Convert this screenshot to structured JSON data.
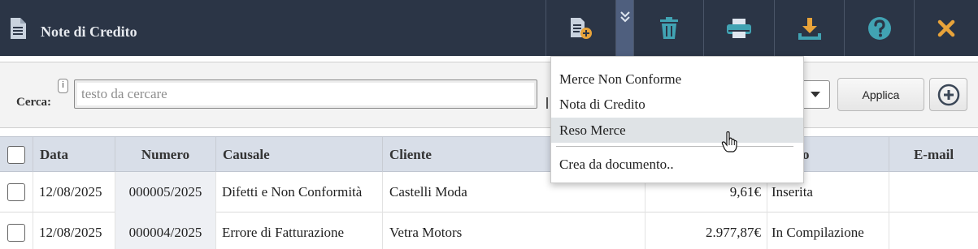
{
  "header": {
    "title": "Note di Credito",
    "icons": [
      "document-icon",
      "new-document-icon",
      "chevron-down-double-icon",
      "trash-icon",
      "print-icon",
      "download-icon",
      "help-icon",
      "close-icon"
    ],
    "colors": {
      "bar": "#2b3546",
      "accent_orange": "#e8a33a",
      "icon_teal": "#41a3b3"
    }
  },
  "search": {
    "label": "Cerca:",
    "info": "i",
    "placeholder": "testo da cercare",
    "value": ""
  },
  "filter": {
    "apply_label": "Applica"
  },
  "table": {
    "columns": [
      "Data",
      "Numero",
      "Causale",
      "Cliente",
      "",
      "o",
      "E-mail"
    ],
    "rows": [
      {
        "date": "12/08/2025",
        "number": "000005/2025",
        "reason": "Difetti e Non Conformità",
        "client": "Castelli Moda",
        "amount": "9,61€",
        "status": "Inserita",
        "email": ""
      },
      {
        "date": "12/08/2025",
        "number": "000004/2025",
        "reason": "Errore di Fatturazione",
        "client": "Vetra Motors",
        "amount": "2.977,87€",
        "status": "In Compilazione",
        "email": ""
      }
    ]
  },
  "menu": {
    "items": [
      "Merce Non Conforme",
      "Nota di Credito",
      "Reso Merce"
    ],
    "create_from": "Crea da documento..",
    "hovered_index": 2
  }
}
